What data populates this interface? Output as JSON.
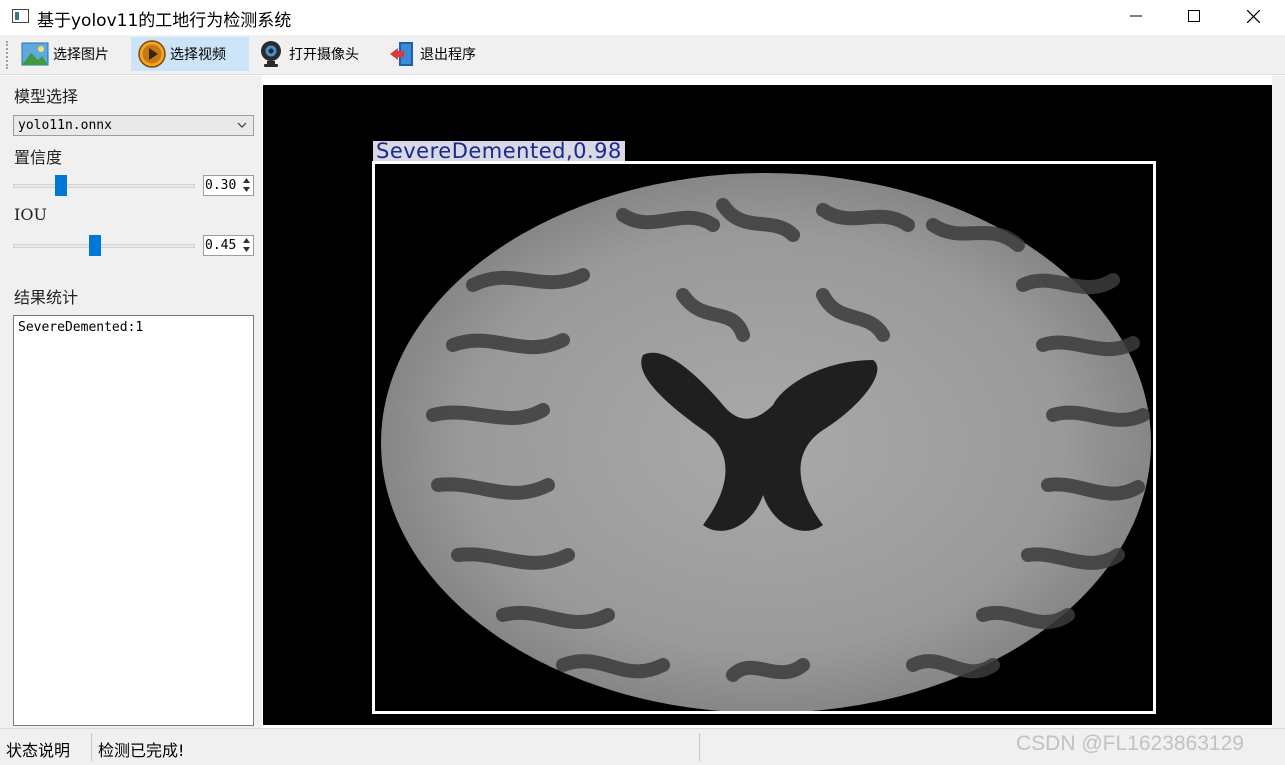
{
  "window": {
    "title": "基于yolov11的工地行为检测系统"
  },
  "toolbar": {
    "items": [
      {
        "label": "选择图片",
        "icon": "image-picture-icon"
      },
      {
        "label": "选择视频",
        "icon": "video-play-icon",
        "active": true
      },
      {
        "label": "打开摄像头",
        "icon": "webcam-icon"
      },
      {
        "label": "退出程序",
        "icon": "exit-door-icon"
      }
    ]
  },
  "sidebar": {
    "model_label": "模型选择",
    "model_value": "yolo11n.onnx",
    "confidence_label": "置信度",
    "confidence_value": "0.30",
    "iou_label": "IOU",
    "iou_value": "0.45",
    "results_label": "结果统计",
    "results_text": "SevereDemented:1"
  },
  "detection": {
    "label": "SevereDemented,0.98",
    "class": "SevereDemented",
    "confidence": 0.98
  },
  "statusbar": {
    "title": "状态说明",
    "message": "检测已完成!",
    "watermark": "CSDN @FL1623863129"
  },
  "colors": {
    "accent": "#0078d7",
    "toolbar_active": "#cce4f7",
    "box_stroke": "#ffffff",
    "label_text": "#1c2a8c"
  }
}
